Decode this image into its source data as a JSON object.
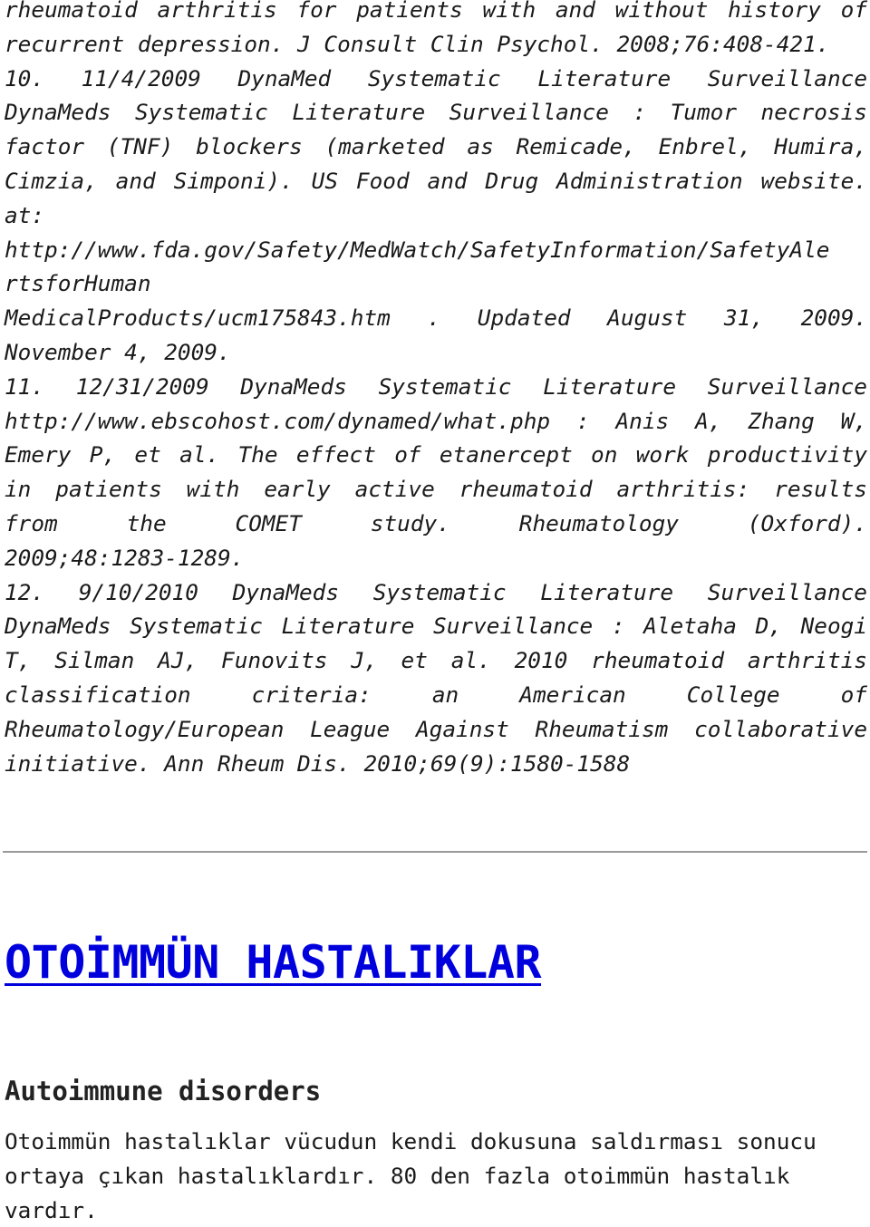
{
  "references": {
    "lines": [
      {
        "text": "rheumatoid arthritis for patients with and without history of",
        "justify": true
      },
      {
        "text": "recurrent depression. J Consult Clin Psychol. 2008;76:408-421.",
        "justify": false
      },
      {
        "text": "10. 11/4/2009 DynaMed Systematic Literature Surveillance",
        "justify": true
      },
      {
        "text": "DynaMeds Systematic Literature Surveillance : Tumor necrosis",
        "justify": true
      },
      {
        "text": "factor (TNF) blockers (marketed as Remicade, Enbrel, Humira,",
        "justify": true
      },
      {
        "text": "Cimzia, and Simponi). US Food and Drug Administration website.",
        "justify": true
      },
      {
        "text": "at:",
        "justify": true
      },
      {
        "text": "http://www.fda.gov/Safety/MedWatch/SafetyInformation/SafetyAle",
        "justify": false
      },
      {
        "text": "rtsforHuman",
        "justify": false
      },
      {
        "text": "MedicalProducts/ucm175843.htm . Updated August 31, 2009.",
        "justify": true
      },
      {
        "text": "November 4, 2009.",
        "justify": false
      },
      {
        "text": "11. 12/31/2009 DynaMeds Systematic Literature Surveillance",
        "justify": true
      },
      {
        "text": "http://www.ebscohost.com/dynamed/what.php : Anis A, Zhang W,",
        "justify": true
      },
      {
        "text": "Emery P, et al. The effect of etanercept on work productivity",
        "justify": true
      },
      {
        "text": "in patients with early active rheumatoid arthritis: results",
        "justify": true
      },
      {
        "text": "from the COMET study. Rheumatology (Oxford).",
        "justify": true
      },
      {
        "text": "2009;48:1283-1289.",
        "justify": false
      },
      {
        "text": "12. 9/10/2010 DynaMeds Systematic Literature Surveillance",
        "justify": true
      },
      {
        "text": "DynaMeds Systematic Literature Surveillance : Aletaha D, Neogi",
        "justify": true
      },
      {
        "text": "T, Silman AJ, Funovits J, et al. 2010 rheumatoid arthritis",
        "justify": true
      },
      {
        "text": "classification criteria: an American College of",
        "justify": true
      },
      {
        "text": "Rheumatology/European League Against Rheumatism collaborative",
        "justify": true
      },
      {
        "text": "initiative. Ann Rheum Dis. 2010;69(9):1580-1588",
        "justify": false
      }
    ]
  },
  "article": {
    "title": "OTOİMMÜN HASTALIKLAR",
    "title_color": "#0000dd",
    "subtitle": "Autoimmune disorders",
    "body_lines": [
      "Otoimmün hastalıklar vücudun kendi dokusuna saldırması sonucu",
      "ortaya çıkan hastalıklardır. 80 den fazla otoimmün hastalık",
      "vardır."
    ]
  }
}
